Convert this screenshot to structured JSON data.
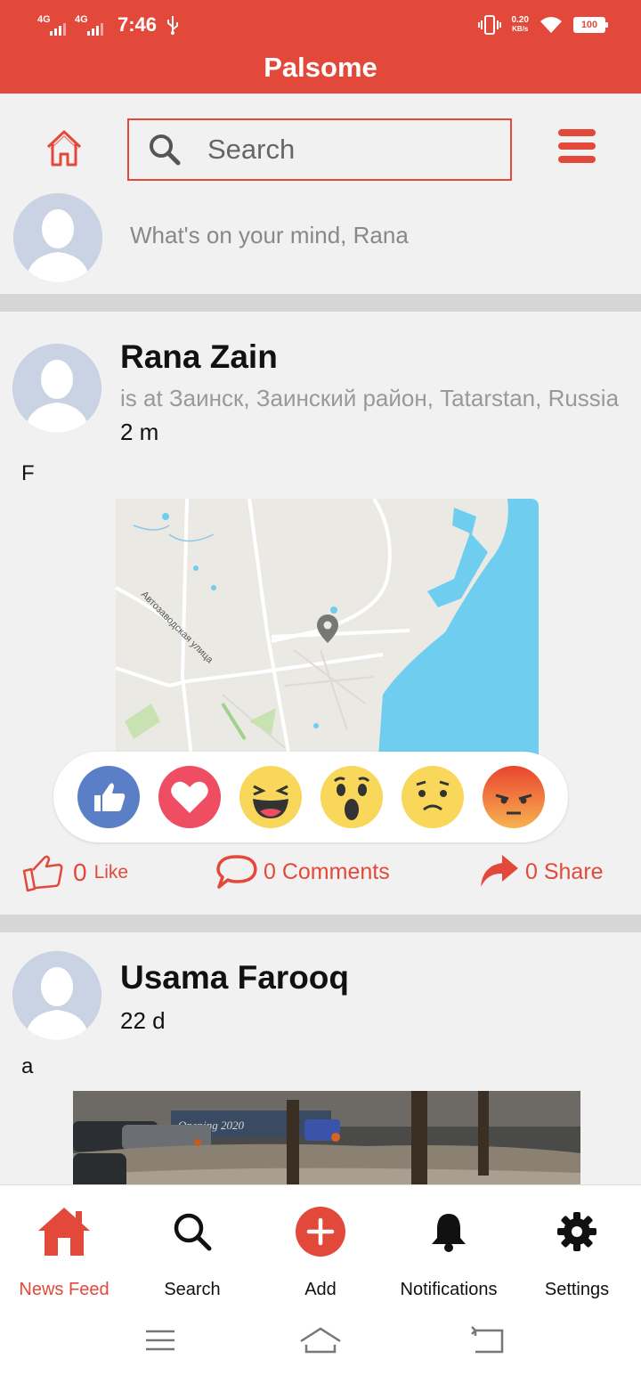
{
  "status_bar": {
    "network_1": "4G",
    "network_2": "4G",
    "time": "7:46",
    "speed_value": "0.20",
    "speed_unit": "KB/s",
    "battery": "100"
  },
  "app": {
    "title": "Palsome"
  },
  "toolbar": {
    "search_placeholder": "Search"
  },
  "composer": {
    "placeholder": "What's on your mind, Rana"
  },
  "posts": [
    {
      "author": "Rana Zain",
      "location": "is at Заинск, Заинский район, Tatarstan, Russia",
      "time": "2 m",
      "text": "F",
      "reactions": [
        "like",
        "love",
        "haha",
        "wow",
        "sad",
        "angry"
      ],
      "like_count": "0",
      "like_label": "Like",
      "comments_label": "0 Comments",
      "share_label": "0 Share",
      "map_label": "Автозаводская улица"
    },
    {
      "author": "Usama Farooq",
      "time": "22 d",
      "text": "a",
      "photo_sign": "Opening 2020"
    }
  ],
  "bottom_nav": {
    "items": [
      {
        "label": "News Feed",
        "icon": "home-icon",
        "active": true
      },
      {
        "label": "Search",
        "icon": "search-icon",
        "active": false
      },
      {
        "label": "Add",
        "icon": "add-icon",
        "active": false
      },
      {
        "label": "Notifications",
        "icon": "bell-icon",
        "active": false
      },
      {
        "label": "Settings",
        "icon": "gear-icon",
        "active": false
      }
    ]
  },
  "colors": {
    "accent": "#e2493a",
    "background": "#f1f1f1",
    "water": "#6fcdf0"
  }
}
